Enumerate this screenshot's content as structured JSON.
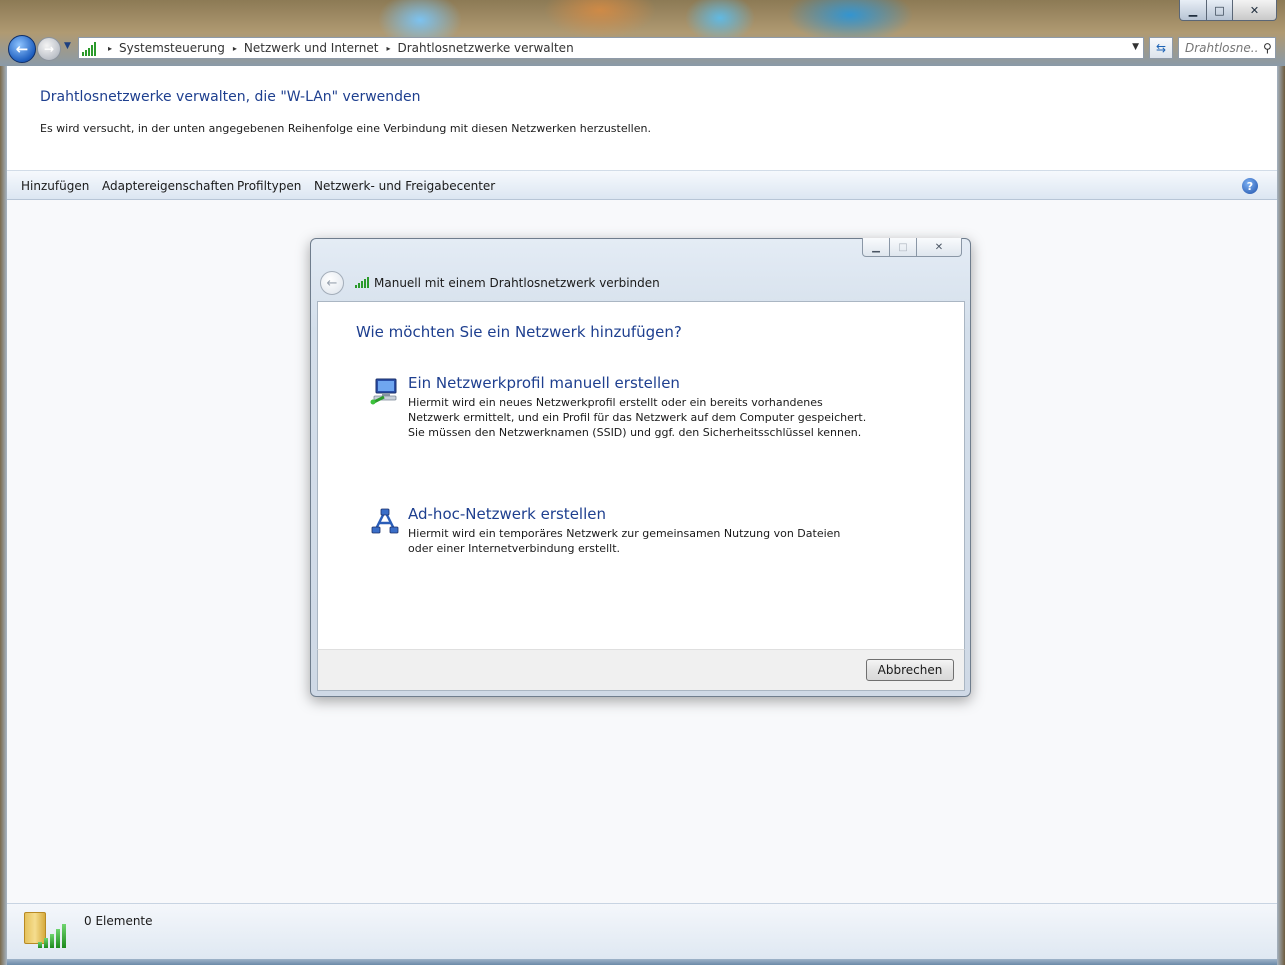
{
  "window": {
    "minimize_glyph": "▁",
    "maximize_glyph": "□",
    "close_glyph": "✕"
  },
  "nav": {
    "back_glyph": "←",
    "forward_glyph": "→",
    "recent_glyph": "▼"
  },
  "address": {
    "crumbs": [
      "Systemsteuerung",
      "Netzwerk und Internet",
      "Drahtlosnetzwerke verwalten"
    ],
    "separator": "▸",
    "dropdown_glyph": "▼",
    "refresh_glyph": "⇆"
  },
  "search": {
    "placeholder": "Drahtlosne...",
    "icon": "search-icon",
    "glyph": "⚲"
  },
  "header": {
    "title": "Drahtlosnetzwerke verwalten, die \"W-LAn\" verwenden",
    "subtitle": "Es wird versucht, in der unten angegebenen Reihenfolge eine Verbindung mit diesen Netzwerken herzustellen."
  },
  "toolbar": {
    "items": [
      "Hinzufügen",
      "Adaptereigenschaften",
      "Profiltypen",
      "Netzwerk- und Freigabecenter"
    ],
    "help_glyph": "?"
  },
  "dialog": {
    "title": "Manuell mit einem Drahtlosnetzwerk verbinden",
    "back_glyph": "←",
    "question": "Wie möchten Sie ein Netzwerk hinzufügen?",
    "options": [
      {
        "title": "Ein Netzwerkprofil manuell erstellen",
        "desc_lines": [
          "Hiermit wird ein neues Netzwerkprofil erstellt oder ein bereits vorhandenes",
          "Netzwerk ermittelt, und ein Profil für das Netzwerk auf dem Computer gespeichert.",
          "Sie müssen den Netzwerknamen (SSID) und ggf. den Sicherheitsschlüssel kennen."
        ],
        "icon": "network-computer-icon"
      },
      {
        "title": "Ad-hoc-Netzwerk erstellen",
        "desc_lines": [
          "Hiermit wird ein temporäres Netzwerk zur gemeinsamen Nutzung von Dateien",
          "oder einer Internetverbindung erstellt."
        ],
        "icon": "adhoc-network-icon"
      }
    ],
    "cancel_label": "Abbrechen"
  },
  "status": {
    "text": "0 Elemente"
  },
  "colors": {
    "accent_blue": "#1e3f8f",
    "signal_green": "#2b9a2b"
  }
}
